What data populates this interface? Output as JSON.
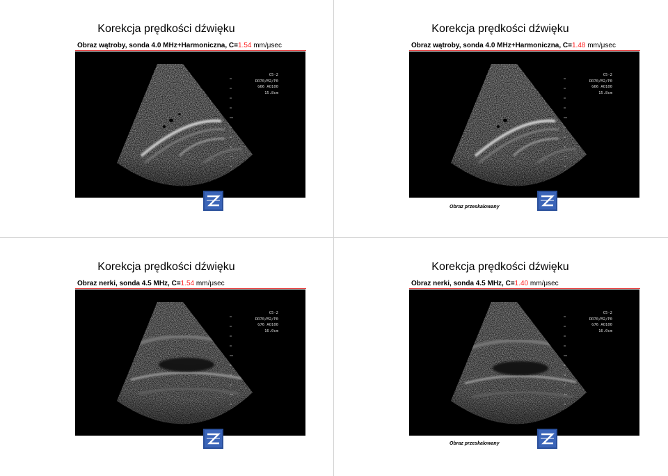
{
  "slides": [
    {
      "title": "Korekcja prędkości dźwięku",
      "subtitle_prefix": "Obraz wątroby, sonda 4.0 MHz+Harmoniczna, C=",
      "subtitle_value": "1.54",
      "subtitle_suffix": " mm/μsec",
      "readout": [
        "C5-2",
        "DR70/M2/P0",
        "G66  AO100",
        "15.8cm"
      ],
      "caption": ""
    },
    {
      "title": "Korekcja prędkości dźwięku",
      "subtitle_prefix": "Obraz wątroby, sonda 4.0 MHz+Harmoniczna, C=",
      "subtitle_value": "1.48",
      "subtitle_suffix": " mm/μsec",
      "readout": [
        "C5-2",
        "DR70/M2/P0",
        "G66  AO100",
        "15.8cm"
      ],
      "caption": "Obraz przeskalowany"
    },
    {
      "title": "Korekcja prędkości dźwięku",
      "subtitle_prefix": "Obraz nerki, sonda 4.5 MHz, C=",
      "subtitle_value": "1.54",
      "subtitle_suffix": " mm/μsec",
      "readout": [
        "C5-2",
        "DR70/M2/P0",
        "G76  AO100",
        "16.0cm"
      ],
      "caption": ""
    },
    {
      "title": "Korekcja prędkości dźwięku",
      "subtitle_prefix": "Obraz nerki, sonda 4.5 MHz, C=",
      "subtitle_value": "1.40",
      "subtitle_suffix": " mm/μsec",
      "readout": [
        "C5-2",
        "DR70/M2/P0",
        "G76  AO100",
        "16.0cm"
      ],
      "caption": "Obraz przeskalowany"
    }
  ],
  "colors": {
    "highlight": "#ff2020",
    "rule": "#e84040",
    "topbar": "#243848",
    "logo_blue": "#2a4f9a"
  },
  "icons": {
    "logo": "z-logo-icon"
  }
}
